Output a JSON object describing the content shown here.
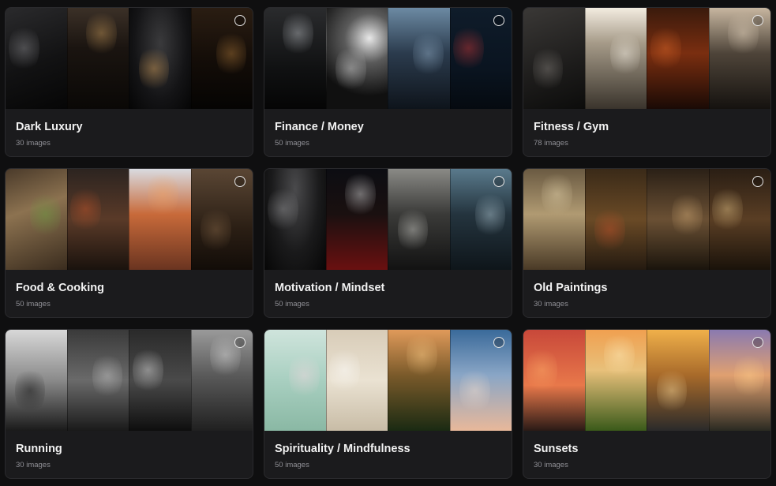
{
  "collections": [
    {
      "title": "Dark Luxury",
      "count": "30 images",
      "thumbs": [
        {
          "name": "watch-on-marble",
          "bg": "linear-gradient(160deg,#2a2a2c 0%,#121213 55%,#060606 100%)",
          "accent": "#8c8c90"
        },
        {
          "name": "luxury-hallway",
          "bg": "linear-gradient(180deg,#3b3027 0%,#1a1410 40%,#0a0806 100%)",
          "accent": "#c89a5a"
        },
        {
          "name": "jet-cabin",
          "bg": "radial-gradient(ellipse at 50% 35%,#3a3a3c 0%,#141416 60%,#050505 100%)",
          "accent": "#d9a25a"
        },
        {
          "name": "wine-cellar",
          "bg": "linear-gradient(180deg,#2a1d12 0%,#140d08 50%,#050403 100%)",
          "accent": "#b07a3a"
        }
      ]
    },
    {
      "title": "Finance / Money",
      "count": "50 images",
      "thumbs": [
        {
          "name": "server-corridor",
          "bg": "linear-gradient(180deg,#2a2b2d 0%,#101112 60%,#050505 100%)",
          "accent": "#bfc3c8"
        },
        {
          "name": "spiral-staircase",
          "bg": "radial-gradient(circle at 70% 30%,#e8e8e8 0%,#5a5a5a 30%,#101010 70%)",
          "accent": "#dcdcdc"
        },
        {
          "name": "city-skyline",
          "bg": "linear-gradient(180deg,#6c8aa3 0%,#2b3b4d 45%,#0e141b 100%)",
          "accent": "#9ab6cf"
        },
        {
          "name": "stock-chart",
          "bg": "linear-gradient(180deg,#0f1c2a 0%,#0a1420 60%,#050a10 100%)",
          "accent": "#d23a3a"
        }
      ]
    },
    {
      "title": "Fitness / Gym",
      "count": "78 images",
      "thumbs": [
        {
          "name": "athlete-resting",
          "bg": "linear-gradient(160deg,#3a3836 0%,#1d1c1b 60%,#0c0c0b 100%)",
          "accent": "#8a8580"
        },
        {
          "name": "gym-window-light",
          "bg": "linear-gradient(180deg,#f3ece0 0%,#a59a88 35%,#3a342c 100%)",
          "accent": "#fffaf0"
        },
        {
          "name": "orange-lit-gym",
          "bg": "linear-gradient(180deg,#3a1a0c 0%,#7a2e10 45%,#1a0a05 100%)",
          "accent": "#e06a2a"
        },
        {
          "name": "pushup-athlete",
          "bg": "linear-gradient(180deg,#c7b6a0 0%,#4e4439 45%,#15120f 100%)",
          "accent": "#e9d9c2"
        }
      ]
    },
    {
      "title": "Food & Cooking",
      "count": "50 images",
      "thumbs": [
        {
          "name": "cutting-board-herbs",
          "bg": "linear-gradient(160deg,#4a3a2a 0%,#8c7250 40%,#3a2c1e 100%)",
          "accent": "#6aa040"
        },
        {
          "name": "grilled-dishes",
          "bg": "linear-gradient(180deg,#2c2420 0%,#5a3a28 50%,#1a120d 100%)",
          "accent": "#c8562a"
        },
        {
          "name": "seafood-platter",
          "bg": "linear-gradient(180deg,#d9dbe0 0%,#c86a3a 45%,#6a3420 100%)",
          "accent": "#f0a060"
        },
        {
          "name": "coffee-beans",
          "bg": "linear-gradient(180deg,#5a4634 0%,#2a1e14 60%,#120c08 100%)",
          "accent": "#8a6a4a"
        }
      ]
    },
    {
      "title": "Motivation / Mindset",
      "count": "50 images",
      "thumbs": [
        {
          "name": "dumbbells-dark",
          "bg": "radial-gradient(ellipse at 50% 20%,#4a4a4c 0%,#1a1a1b 55%,#060606 100%)",
          "accent": "#9a9a9c"
        },
        {
          "name": "running-track-red",
          "bg": "linear-gradient(180deg,#0c0d12 0%,#1a1010 45%,#6a1010 100%)",
          "accent": "#e0e0e0"
        },
        {
          "name": "light-through-window",
          "bg": "linear-gradient(180deg,#8a8a86 0%,#3a3a38 45%,#121212 100%)",
          "accent": "#d8d8d2"
        },
        {
          "name": "storm-city-rays",
          "bg": "linear-gradient(180deg,#5a7a8c 0%,#24343e 45%,#0e151a 100%)",
          "accent": "#b8d0dc"
        }
      ]
    },
    {
      "title": "Old Paintings",
      "count": "30 images",
      "thumbs": [
        {
          "name": "palace-arch",
          "bg": "linear-gradient(180deg,#6a5a42 0%,#b09a72 45%,#4a3a26 100%)",
          "accent": "#e8d8b0"
        },
        {
          "name": "scholar-in-library",
          "bg": "linear-gradient(180deg,#3a2a18 0%,#6a4a26 50%,#241a10 100%)",
          "accent": "#c8522a"
        },
        {
          "name": "cathedral-interior",
          "bg": "linear-gradient(180deg,#2a2016 0%,#6a5034 50%,#1a140c 100%)",
          "accent": "#d8b07a"
        },
        {
          "name": "banquet-hall",
          "bg": "linear-gradient(180deg,#2a1e14 0%,#5a3e24 50%,#1a120a 100%)",
          "accent": "#e8c88a"
        }
      ]
    },
    {
      "title": "Running",
      "count": "30 images",
      "thumbs": [
        {
          "name": "runner-silhouette-sunrise",
          "bg": "linear-gradient(180deg,#d8d8d8 0%,#8a8a8a 50%,#1a1a1a 100%)",
          "accent": "#0a0a0a"
        },
        {
          "name": "motion-blur-track",
          "bg": "linear-gradient(180deg,#3a3a3a 0%,#6a6a6a 50%,#1a1a1a 100%)",
          "accent": "#cfcfcf"
        },
        {
          "name": "running-shoes-rain",
          "bg": "linear-gradient(180deg,#2a2a2a 0%,#4a4a4a 50%,#0e0e0e 100%)",
          "accent": "#e8e8e8"
        },
        {
          "name": "runner-wet-street",
          "bg": "linear-gradient(180deg,#9a9a9a 0%,#5a5a5a 45%,#202020 100%)",
          "accent": "#e0e0e0"
        }
      ]
    },
    {
      "title": "Spirituality / Mindfulness",
      "count": "50 images",
      "thumbs": [
        {
          "name": "lotus-flower",
          "bg": "linear-gradient(180deg,#cfe4dc 0%,#a8cfc0 50%,#8ab8a4 100%)",
          "accent": "#f4d8e0"
        },
        {
          "name": "plant-and-notebook",
          "bg": "linear-gradient(180deg,#d8ccb8 0%,#eae2d2 50%,#c8bca6 100%)",
          "accent": "#ffffff"
        },
        {
          "name": "forest-sunset",
          "bg": "linear-gradient(180deg,#e09a5a 0%,#7a5a2a 45%,#1a2a12 100%)",
          "accent": "#ffd08a"
        },
        {
          "name": "clouds-blue-sky",
          "bg": "linear-gradient(180deg,#3a6a9a 0%,#8aa6c6 45%,#e8b89a 100%)",
          "accent": "#f4e0d0"
        }
      ]
    },
    {
      "title": "Sunsets",
      "count": "30 images",
      "thumbs": [
        {
          "name": "red-sunset-clouds",
          "bg": "linear-gradient(180deg,#c8483a 0%,#e8784a 55%,#2a1a16 100%)",
          "accent": "#ffb06a"
        },
        {
          "name": "cornfield-sunset",
          "bg": "linear-gradient(180deg,#f0a050 0%,#e8c07a 40%,#3a5a1a 100%)",
          "accent": "#fff0c0"
        },
        {
          "name": "bridge-golden-hour",
          "bg": "linear-gradient(180deg,#f0b04a 0%,#a86a2a 45%,#2a2a2a 100%)",
          "accent": "#ffe0a0"
        },
        {
          "name": "field-dusk",
          "bg": "linear-gradient(180deg,#8a7ab0 0%,#e0a070 45%,#2a2a22 100%)",
          "accent": "#ffcf8a"
        }
      ]
    }
  ]
}
